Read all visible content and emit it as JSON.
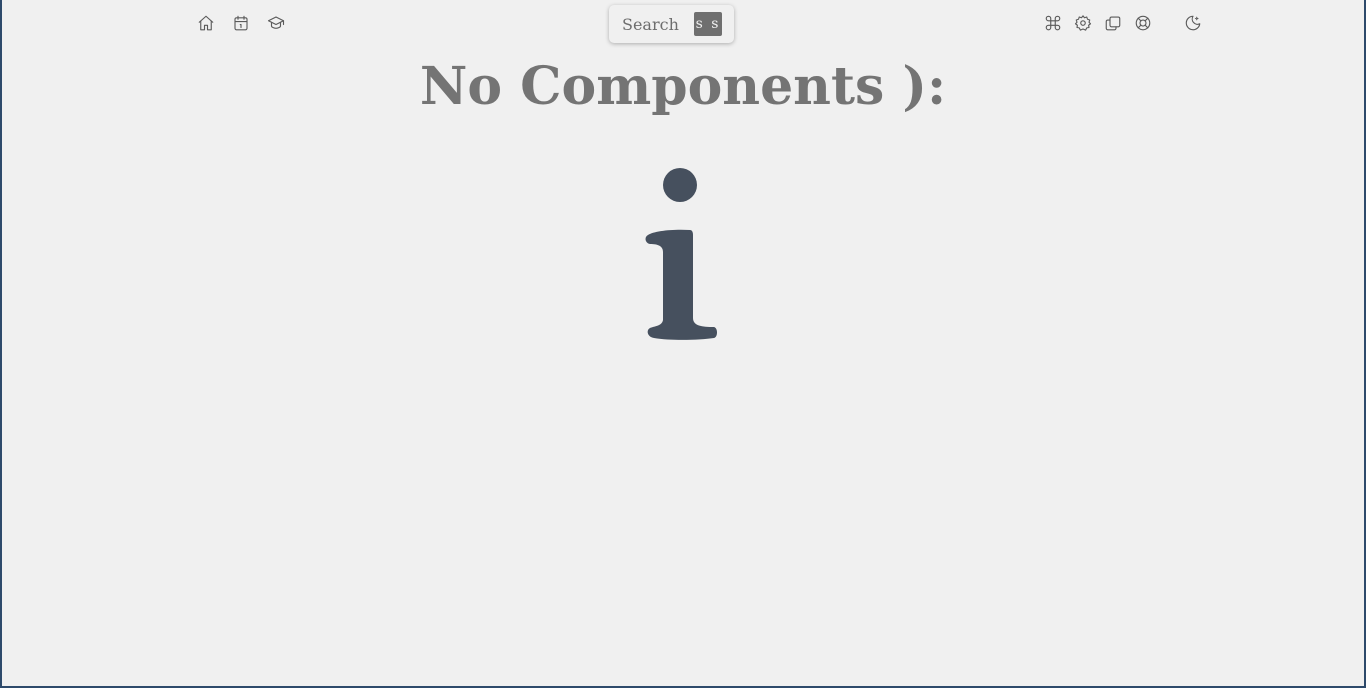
{
  "toolbar_left": [
    {
      "name": "home-icon"
    },
    {
      "name": "calendar-icon"
    },
    {
      "name": "graduation-cap-icon"
    }
  ],
  "toolbar_right": [
    {
      "name": "command-icon"
    },
    {
      "name": "gear-icon"
    },
    {
      "name": "copy-icon"
    },
    {
      "name": "lifebuoy-icon"
    },
    {
      "name": "moon-icon"
    }
  ],
  "search": {
    "label": "Search",
    "shortcut": "s s"
  },
  "main": {
    "empty_title": "No Components ):",
    "info_icon": "info-icon"
  },
  "colors": {
    "background": "#f0f0f0",
    "title": "#747474",
    "info_glyph": "#46505e",
    "border": "#2e4a6b"
  }
}
